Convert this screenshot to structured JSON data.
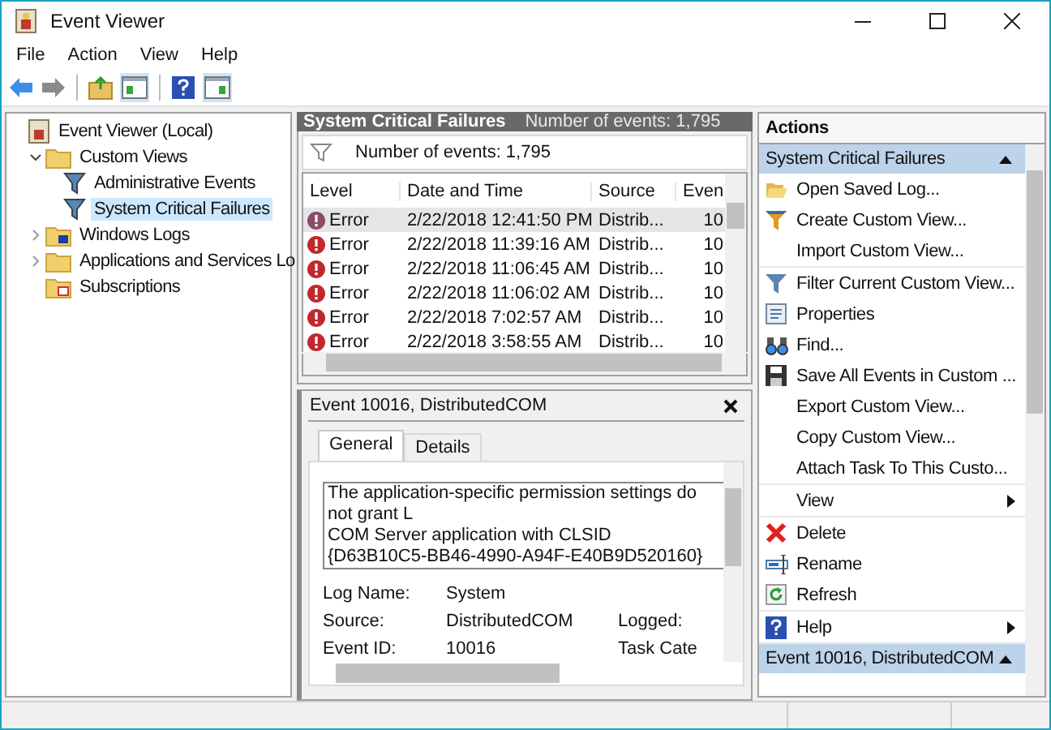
{
  "window": {
    "title": "Event Viewer"
  },
  "menu": [
    "File",
    "Action",
    "View",
    "Help"
  ],
  "tree": [
    {
      "label": "Event Viewer (Local)",
      "kind": "root",
      "selected": false,
      "children": [
        {
          "label": "Custom Views",
          "kind": "folder",
          "expanded": true,
          "selected": false,
          "children": [
            {
              "label": "Administrative Events",
              "kind": "view",
              "selected": false
            },
            {
              "label": "System Critical Failures",
              "kind": "view",
              "selected": true
            }
          ]
        },
        {
          "label": "Windows Logs",
          "kind": "logs",
          "expanded": false,
          "selected": false
        },
        {
          "label": "Applications and Services Lo",
          "kind": "folder",
          "expanded": false,
          "selected": false
        },
        {
          "label": "Subscriptions",
          "kind": "subscriptions",
          "selected": false
        }
      ]
    }
  ],
  "center": {
    "title": "System Critical Failures",
    "count": "Number of events: 1,795",
    "filter_text": "Number of events: 1,795",
    "table": {
      "columns": [
        "Level",
        "Date and Time",
        "Source",
        "Even"
      ],
      "rows": [
        {
          "level": "Error",
          "date": "2/22/2018 12:41:50 PM",
          "source": "Distrib...",
          "event": "10",
          "selected": true
        },
        {
          "level": "Error",
          "date": "2/22/2018 11:39:16 AM",
          "source": "Distrib...",
          "event": "10",
          "selected": false
        },
        {
          "level": "Error",
          "date": "2/22/2018 11:06:45 AM",
          "source": "Distrib...",
          "event": "10",
          "selected": false
        },
        {
          "level": "Error",
          "date": "2/22/2018 11:06:02 AM",
          "source": "Distrib...",
          "event": "10",
          "selected": false
        },
        {
          "level": "Error",
          "date": "2/22/2018 7:02:57 AM",
          "source": "Distrib...",
          "event": "10",
          "selected": false
        },
        {
          "level": "Error",
          "date": "2/22/2018 3:58:55 AM",
          "source": "Distrib...",
          "event": "10",
          "selected": false
        }
      ]
    }
  },
  "details": {
    "title": "Event 10016, DistributedCOM",
    "tabs": [
      {
        "label": "General",
        "selected": true
      },
      {
        "label": "Details",
        "selected": false
      }
    ],
    "message": [
      "The application-specific permission settings do not grant L",
      "COM Server application with CLSID",
      "{D63B10C5-BB46-4990-A94F-E40B9D520160}"
    ],
    "fields": [
      {
        "label": "Log Name:",
        "value": "System"
      },
      {
        "label": "Source:",
        "value": "DistributedCOM",
        "label_2": "Logged:"
      },
      {
        "label": "Event ID:",
        "value": "10016",
        "label_2": "Task Cate"
      }
    ]
  },
  "actions": {
    "title": "Actions",
    "sections": [
      {
        "title": "System Critical Failures",
        "expanded": true,
        "groups": [
          [
            {
              "label": "Open Saved Log...",
              "submenu": false
            },
            {
              "label": "Create Custom View...",
              "submenu": false
            },
            {
              "label": "Import Custom View...",
              "submenu": false
            }
          ],
          [
            {
              "label": "Filter Current Custom View...",
              "submenu": false
            },
            {
              "label": "Properties",
              "submenu": false
            },
            {
              "label": "Find...",
              "submenu": false
            },
            {
              "label": "Save All Events in Custom ...",
              "submenu": false
            },
            {
              "label": "Export Custom View...",
              "submenu": false
            },
            {
              "label": "Copy Custom View...",
              "submenu": false
            },
            {
              "label": "Attach Task To This Custo...",
              "submenu": false
            }
          ],
          [
            {
              "label": "View",
              "submenu": true
            }
          ],
          [
            {
              "label": "Delete",
              "submenu": false
            },
            {
              "label": "Rename",
              "submenu": false
            },
            {
              "label": "Refresh",
              "submenu": false
            }
          ],
          [
            {
              "label": "Help",
              "submenu": true
            }
          ]
        ]
      },
      {
        "title": "Event 10016, DistributedCOM",
        "expanded": true
      }
    ]
  }
}
